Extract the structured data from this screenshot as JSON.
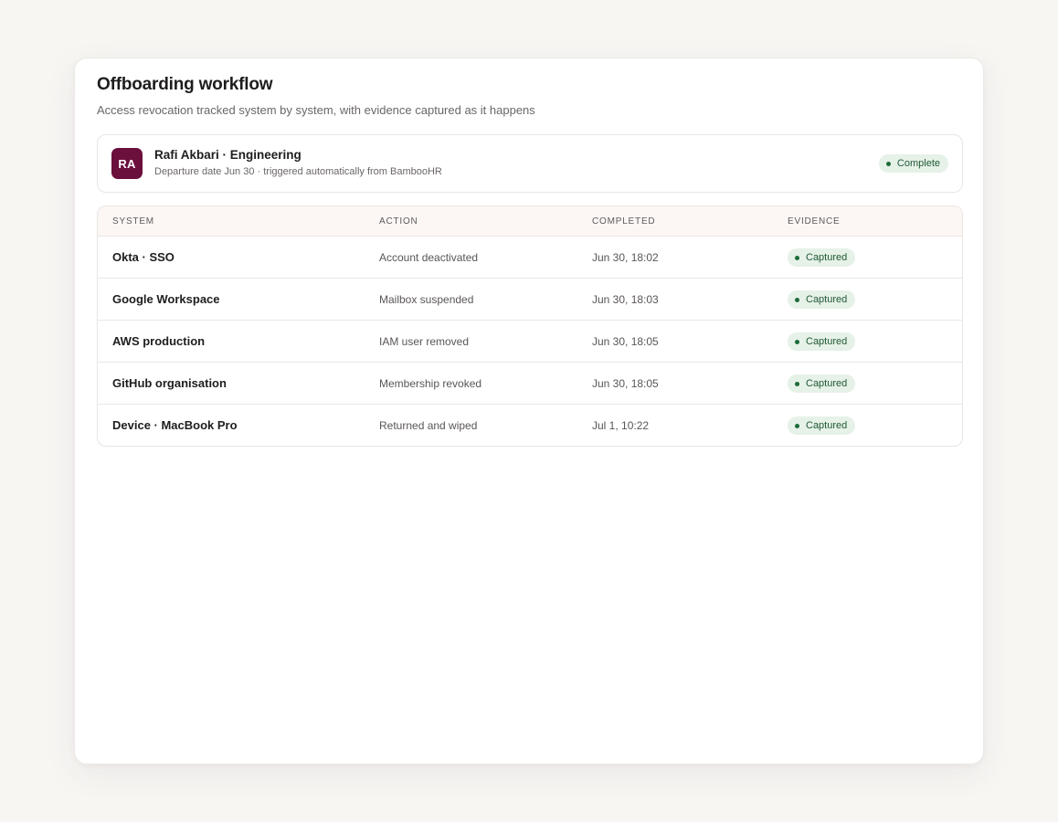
{
  "header": {
    "title": "Offboarding workflow",
    "subtitle": "Access revocation tracked system by system, with evidence captured as it happens"
  },
  "person": {
    "initials": "RA",
    "name": "Rafi Akbari · Engineering",
    "meta": "Departure date Jun 30 · triggered automatically from BambooHR",
    "status": "Complete",
    "avatar_color": "#6b0f3d"
  },
  "table": {
    "columns": {
      "system": "SYSTEM",
      "action": "ACTION",
      "completed": "COMPLETED",
      "evidence": "EVIDENCE"
    },
    "rows": [
      {
        "system": "Okta · SSO",
        "action": "Account deactivated",
        "completed": "Jun 30, 18:02",
        "evidence": "Captured"
      },
      {
        "system": "Google Workspace",
        "action": "Mailbox suspended",
        "completed": "Jun 30, 18:03",
        "evidence": "Captured"
      },
      {
        "system": "AWS production",
        "action": "IAM user removed",
        "completed": "Jun 30, 18:05",
        "evidence": "Captured"
      },
      {
        "system": "GitHub organisation",
        "action": "Membership revoked",
        "completed": "Jun 30, 18:05",
        "evidence": "Captured"
      },
      {
        "system": "Device · MacBook Pro",
        "action": "Returned and wiped",
        "completed": "Jul 1, 10:22",
        "evidence": "Captured"
      }
    ]
  },
  "colors": {
    "badge_bg": "#e6f1e8",
    "badge_text": "#1f5a33",
    "header_row_bg": "#fcf7f5"
  }
}
